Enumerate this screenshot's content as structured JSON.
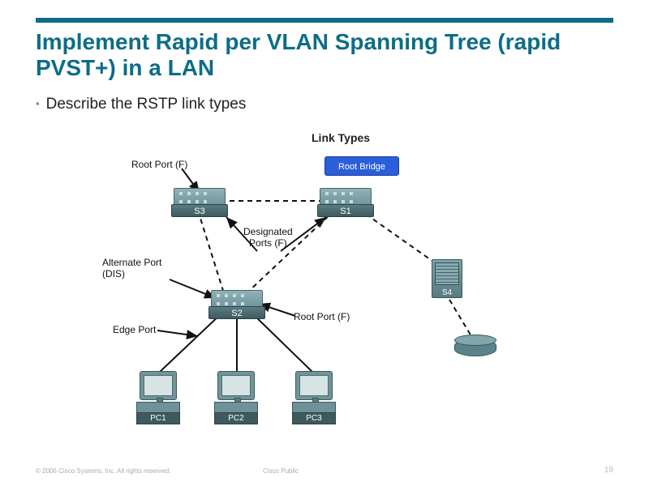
{
  "title": "Implement Rapid per VLAN Spanning Tree (rapid PVST+) in a LAN",
  "bullet": "Describe the RSTP link types",
  "diagram": {
    "title": "Link Types",
    "root_bridge": "Root Bridge",
    "switches": {
      "s1": "S1",
      "s2": "S2",
      "s3": "S3",
      "s4": "S4"
    },
    "pcs": {
      "pc1": "PC1",
      "pc2": "PC2",
      "pc3": "PC3"
    },
    "labels": {
      "root_port_top": "Root Port (F)",
      "designated": "Designated\nPorts (F)",
      "alternate": "Alternate Port\n(DIS)",
      "edge": "Edge Port",
      "root_port_bottom": "Root Port (F)"
    }
  },
  "footer": {
    "copyright": "© 2006 Cisco Systems, Inc. All rights reserved.",
    "public": "Cisco Public"
  },
  "page_number": "19"
}
